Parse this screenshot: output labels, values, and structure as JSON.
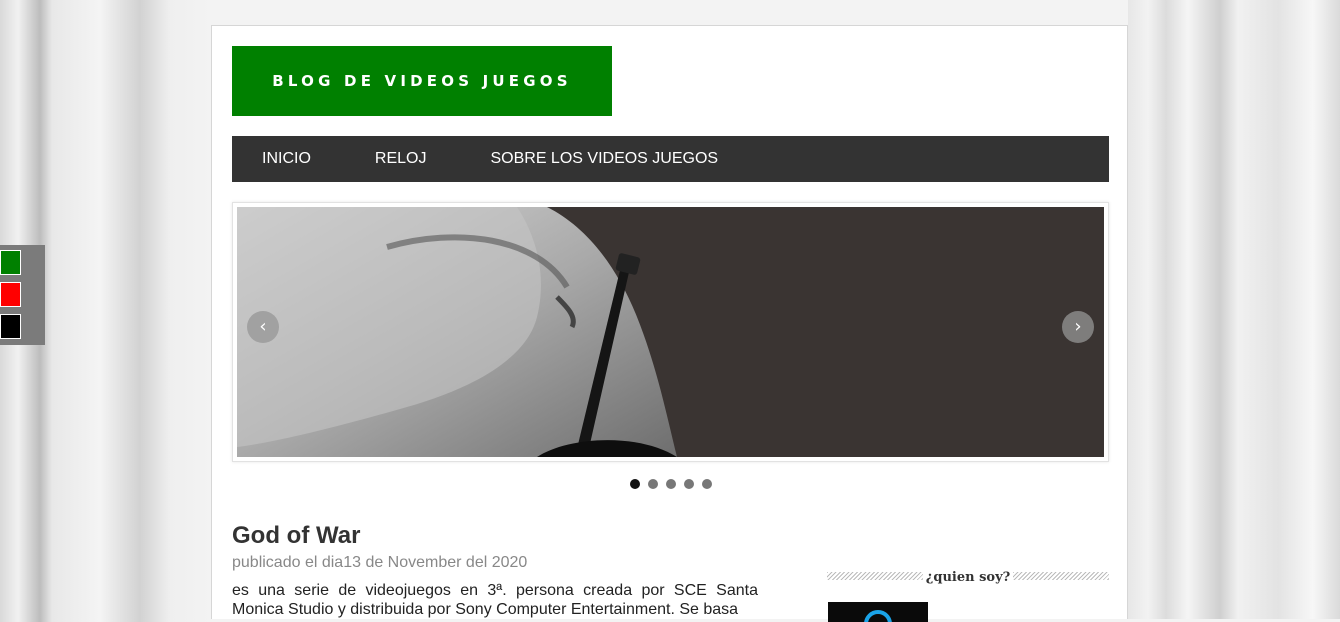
{
  "blog": {
    "title": "BLOG DE VIDEOS JUEGOS"
  },
  "nav": {
    "items": [
      "INICIO",
      "RELOJ",
      "SOBRE LOS VIDEOS JUEGOS"
    ]
  },
  "slider": {
    "prev": "‹",
    "next": "›",
    "slides": 5,
    "active": 0
  },
  "post": {
    "title": "God of War",
    "meta": "publicado el dia13 de November del 2020",
    "body": "es una serie de videojuegos en 3ª. persona creada por SCE Santa Monica Studio y distribuida por Sony Computer Entertainment. Se basa"
  },
  "sidebar": {
    "widget_title": "¿quien soy?"
  },
  "palette": {
    "colors": [
      "#008000",
      "#ff0000",
      "#000000"
    ]
  }
}
